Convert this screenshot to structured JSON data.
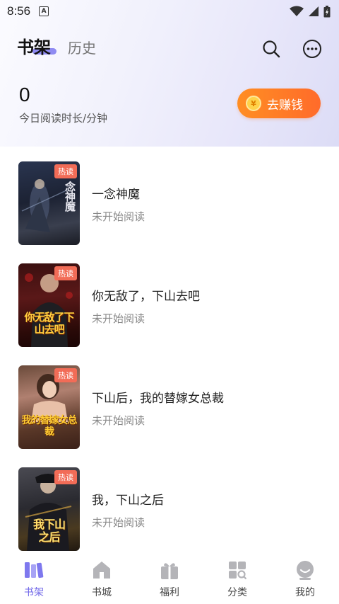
{
  "status_bar": {
    "time": "8:56",
    "notification_letter": "A"
  },
  "tabs": [
    {
      "label": "书架",
      "active": true
    },
    {
      "label": "历史",
      "active": false
    }
  ],
  "header_icons": [
    "search-icon",
    "more-icon"
  ],
  "reading": {
    "minutes": "0",
    "label": "今日阅读时长/分钟"
  },
  "earn_button": {
    "label": "去赚钱",
    "icon": "coin-icon"
  },
  "books": [
    {
      "title": "一念神魔",
      "status": "未开始阅读",
      "badge": "热读",
      "cover_text": "念神魔"
    },
    {
      "title": "你无敌了，下山去吧",
      "status": "未开始阅读",
      "badge": "热读",
      "cover_text": "你无敌了下山去吧"
    },
    {
      "title": "下山后，我的替嫁女总裁",
      "status": "未开始阅读",
      "badge": "热读",
      "cover_text": "我的替嫁女总裁"
    },
    {
      "title": "我，下山之后",
      "status": "未开始阅读",
      "badge": "热读",
      "cover_text": "我下山之后"
    }
  ],
  "bottom_nav": [
    {
      "label": "书架",
      "icon": "bookshelf-icon",
      "active": true
    },
    {
      "label": "书城",
      "icon": "bookstore-icon",
      "active": false
    },
    {
      "label": "福利",
      "icon": "gift-icon",
      "active": false
    },
    {
      "label": "分类",
      "icon": "category-icon",
      "active": false
    },
    {
      "label": "我的",
      "icon": "profile-icon",
      "active": false
    }
  ],
  "colors": {
    "accent": "#6f66e8",
    "earn_orange": "#ff7a26",
    "hot_badge": "#f26c57"
  }
}
